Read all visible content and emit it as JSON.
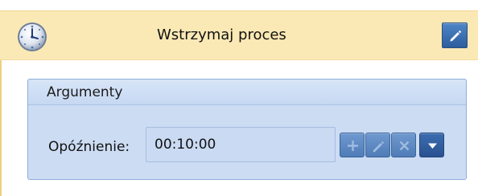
{
  "activity": {
    "title": "Wstrzymaj proces",
    "icon": "clock-icon",
    "edit_icon": "pencil-icon"
  },
  "arguments": {
    "title": "Argumenty",
    "delay": {
      "label": "Opóźnienie:",
      "value": "00:10:00"
    },
    "buttons": {
      "add_icon": "plus-icon",
      "edit_icon": "pencil-icon",
      "remove_icon": "x-icon",
      "menu_icon": "chevron-down-icon"
    }
  },
  "colors": {
    "header_bg": "#fbe9b5",
    "group_bg": "#ccdcf3",
    "button_blue": "#2d5d9c"
  }
}
